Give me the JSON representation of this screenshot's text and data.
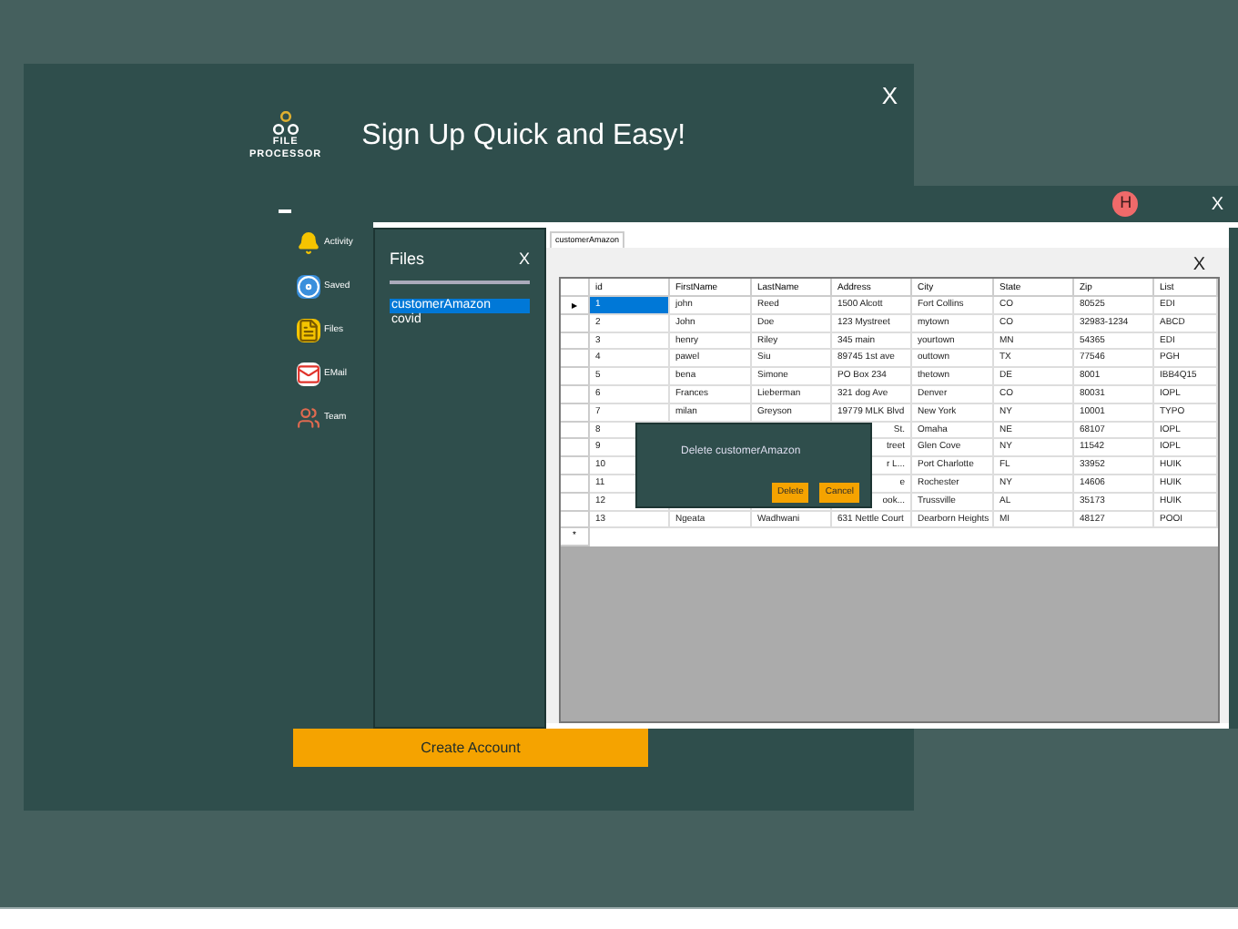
{
  "main_window": {
    "close": "X",
    "logo_lines": [
      "FILE",
      "PROCESSOR"
    ],
    "title": "Sign Up Quick and Easy!",
    "nav": [
      {
        "kind": "activity",
        "label": "Activity"
      },
      {
        "kind": "saved",
        "label": "Saved"
      },
      {
        "kind": "files",
        "label": "Files"
      },
      {
        "kind": "email",
        "label": "EMail"
      },
      {
        "kind": "team",
        "label": "Team"
      }
    ],
    "create_button": "Create Account"
  },
  "data_window": {
    "avatar": "H",
    "close": "X",
    "files_panel": {
      "title": "Files",
      "close": "X",
      "files": [
        {
          "name": "customerAmazon",
          "selected": true
        },
        {
          "name": "covid",
          "selected": false
        }
      ]
    },
    "tab": {
      "label": "customerAmazon",
      "selected": true
    },
    "grid_close": "X",
    "columns": [
      "id",
      "FirstName",
      "LastName",
      "Address",
      "City",
      "State",
      "Zip",
      "List"
    ],
    "rows": [
      {
        "marker": "▶",
        "selected": true,
        "cells": [
          "1",
          "john",
          "Reed",
          "1500 Alcott",
          "Fort Collins",
          "CO",
          "80525",
          "EDI"
        ]
      },
      {
        "selected": false,
        "cells": [
          "2",
          "John",
          "Doe",
          "123 Mystreet",
          "mytown",
          "CO",
          "32983-1234",
          "ABCD"
        ]
      },
      {
        "selected": false,
        "cells": [
          "3",
          "henry",
          "Riley",
          "345 main",
          "yourtown",
          "MN",
          "54365",
          "EDI"
        ]
      },
      {
        "selected": false,
        "cells": [
          "4",
          "pawel",
          "Siu",
          "89745 1st ave",
          "outtown",
          "TX",
          "77546",
          "PGH"
        ]
      },
      {
        "selected": false,
        "cells": [
          "5",
          "bena",
          "Simone",
          "PO Box 234",
          "thetown",
          "DE",
          "8001",
          "IBB4Q15"
        ]
      },
      {
        "selected": false,
        "cells": [
          "6",
          "Frances",
          "Lieberman",
          "321 dog Ave",
          "Denver",
          "CO",
          "80031",
          "IOPL"
        ]
      },
      {
        "selected": false,
        "cells": [
          "7",
          "milan",
          "Greyson",
          "19779 MLK Blvd",
          "New York",
          "NY",
          "10001",
          "TYPO"
        ]
      },
      {
        "selected": false,
        "cells": [
          "8",
          null,
          null,
          "St.",
          "Omaha",
          "NE",
          "68107",
          "IOPL"
        ]
      },
      {
        "selected": false,
        "cells": [
          "9",
          null,
          null,
          "treet",
          "Glen Cove",
          "NY",
          "11542",
          "IOPL"
        ]
      },
      {
        "selected": false,
        "cells": [
          "10",
          null,
          null,
          "r L...",
          "Port Charlotte",
          "FL",
          "33952",
          "HUIK"
        ]
      },
      {
        "selected": false,
        "cells": [
          "11",
          null,
          null,
          "e",
          "Rochester",
          "NY",
          "14606",
          "HUIK"
        ]
      },
      {
        "selected": false,
        "cells": [
          "12",
          null,
          null,
          "ook...",
          "Trussville",
          "AL",
          "35173",
          "HUIK"
        ]
      },
      {
        "selected": false,
        "cells": [
          "13",
          "Ngeata",
          "Wadhwani",
          "631 Nettle Court",
          "Dearborn Heights",
          "MI",
          "48127",
          "POOI"
        ]
      }
    ],
    "new_row_marker": "*"
  },
  "dialog": {
    "message": "Delete customerAmazon",
    "buttons": [
      "Delete",
      "Cancel"
    ]
  }
}
